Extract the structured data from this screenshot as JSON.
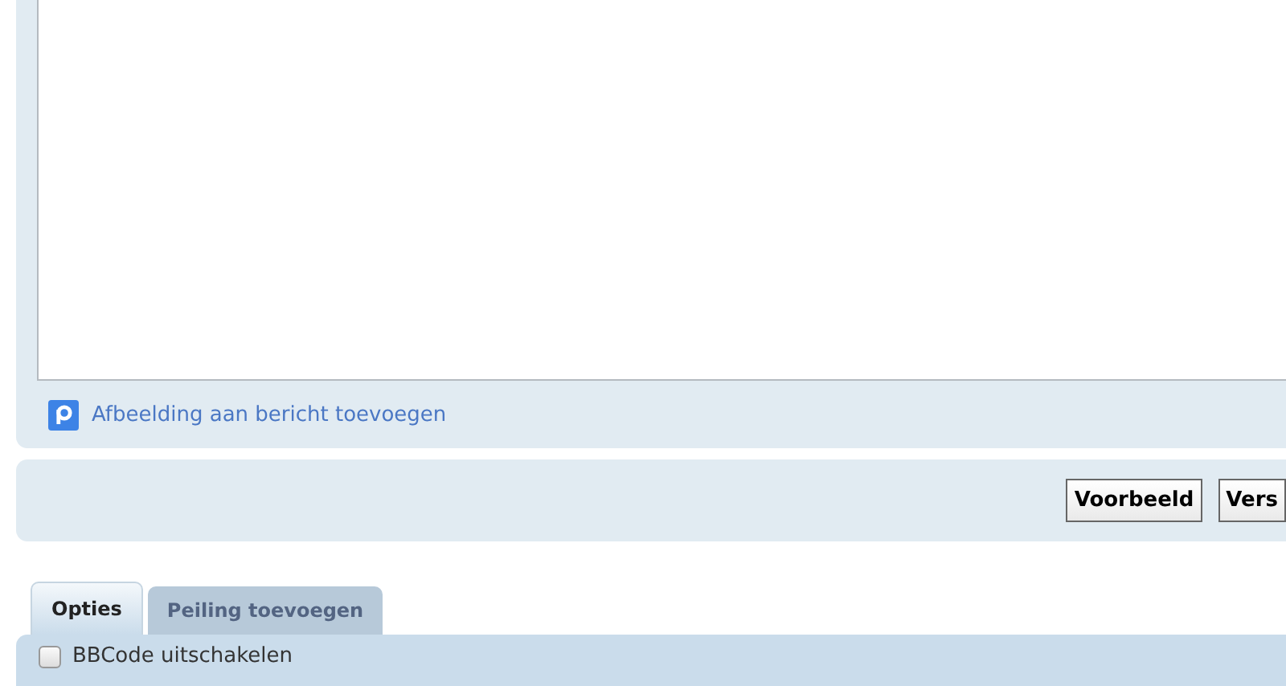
{
  "attach_link": {
    "label": "Afbeelding aan bericht toevoegen"
  },
  "buttons": [
    "Voorbeeld",
    "Vers"
  ],
  "tabs": [
    {
      "label": "Opties",
      "selected": true
    },
    {
      "label": "Peiling toevoegen",
      "selected": false
    }
  ],
  "options": [
    {
      "label": "BBCode uitschakelen",
      "checked": false
    }
  ]
}
